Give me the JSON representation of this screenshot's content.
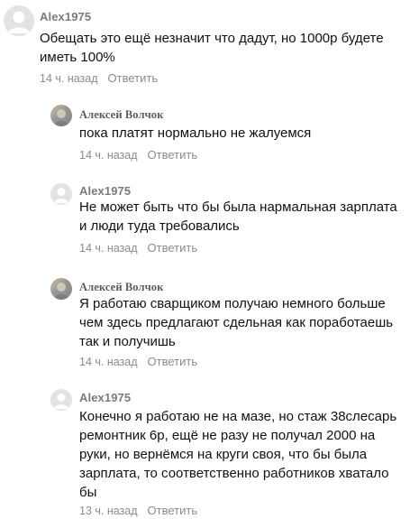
{
  "comments": [
    {
      "author": "Alex1975",
      "text": "Обещать это ещё незначит что дадут, но 1000р будете иметь 100%",
      "time": "14 ч. назад",
      "reply": "Ответить",
      "avatar": "user-placeholder-icon"
    },
    {
      "author": "Алексей Волчок",
      "text": "пока платят нормально не жалуемся",
      "time": "14 ч. назад",
      "reply": "Ответить",
      "avatar": "user-photo"
    },
    {
      "author": "Alex1975",
      "text": "Не может быть что бы была нармальная зарплата и люди туда требовались",
      "time": "14 ч. назад",
      "reply": "Ответить",
      "avatar": "user-placeholder-icon"
    },
    {
      "author": "Алексей Волчок",
      "text": "Я работаю сварщиком получаю немного больше чем здесь предлагают сдельная как поработаешь так и получишь",
      "time": "14 ч. назад",
      "reply": "Ответить",
      "avatar": "user-photo"
    },
    {
      "author": "Alex1975",
      "text": "Конечно я работаю не на мазе, но стаж 38слесарь ремонтник 6р, ещё не разу не получал 2000 на руки, но вернёмся на круги своя, что бы была зарплата, то соответственно работников хватало бы",
      "time": "13 ч. назад",
      "reply": "Ответить",
      "avatar": "user-placeholder-icon"
    }
  ]
}
